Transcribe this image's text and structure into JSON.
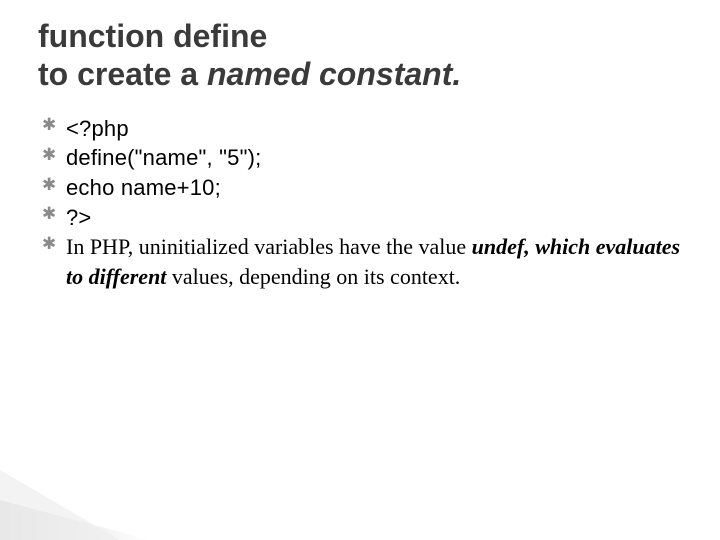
{
  "heading": {
    "line1": "function define",
    "line2_prefix": "to create a ",
    "line2_emph": "named constant."
  },
  "code_lines": [
    "<?php",
    "define(\"name\", \"5\");",
    "echo name+10;",
    "?>"
  ],
  "paragraph": {
    "lead": "In PHP, uninitialized variables have the value ",
    "emph1": "undef,",
    "mid": " ",
    "emph2": "which evaluates to different",
    "tail": "  values, depending on its context."
  },
  "bullet_glyph": "✱"
}
